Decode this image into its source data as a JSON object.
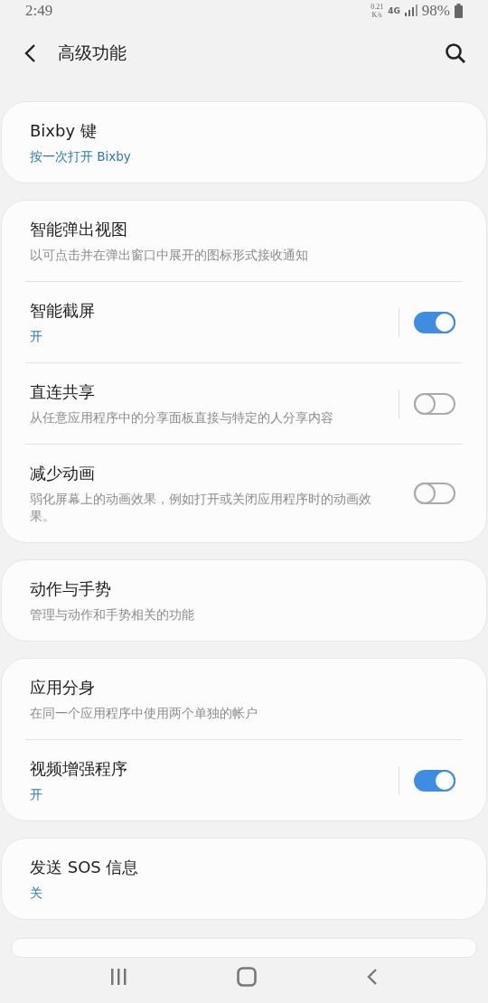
{
  "status_bar": {
    "time": "2:49",
    "speed_value": "0.21",
    "speed_unit": "K/s",
    "network": "4G",
    "battery": "98%"
  },
  "header": {
    "title": "高级功能"
  },
  "groups": [
    {
      "items": [
        {
          "title": "Bixby 键",
          "subtitle": {
            "text": "按一次打开 Bixby",
            "kind": "status"
          }
        }
      ]
    },
    {
      "items": [
        {
          "title": "智能弹出视图",
          "subtitle": {
            "text": "以可点击并在弹出窗口中展开的图标形式接收通知",
            "kind": "description"
          }
        },
        {
          "title": "智能截屏",
          "subtitle": {
            "text": "开",
            "kind": "status"
          },
          "toggle": {
            "on": true,
            "divider": true
          }
        },
        {
          "title": "直连共享",
          "subtitle": {
            "text": "从任意应用程序中的分享面板直接与特定的人分享内容",
            "kind": "description"
          },
          "toggle": {
            "on": false,
            "divider": true
          }
        },
        {
          "title": "减少动画",
          "subtitle": {
            "text": "弱化屏幕上的动画效果，例如打开或关闭应用程序时的动画效果。",
            "kind": "description"
          },
          "toggle": {
            "on": false,
            "divider": false
          }
        }
      ]
    },
    {
      "items": [
        {
          "title": "动作与手势",
          "subtitle": {
            "text": "管理与动作和手势相关的功能",
            "kind": "description"
          }
        }
      ]
    },
    {
      "items": [
        {
          "title": "应用分身",
          "subtitle": {
            "text": "在同一个应用程序中使用两个单独的帐户",
            "kind": "description"
          }
        },
        {
          "title": "视频增强程序",
          "subtitle": {
            "text": "开",
            "kind": "status"
          },
          "toggle": {
            "on": true,
            "divider": true
          }
        }
      ]
    },
    {
      "items": [
        {
          "title": "发送 SOS 信息",
          "subtitle": {
            "text": "关",
            "kind": "status"
          }
        }
      ]
    }
  ]
}
